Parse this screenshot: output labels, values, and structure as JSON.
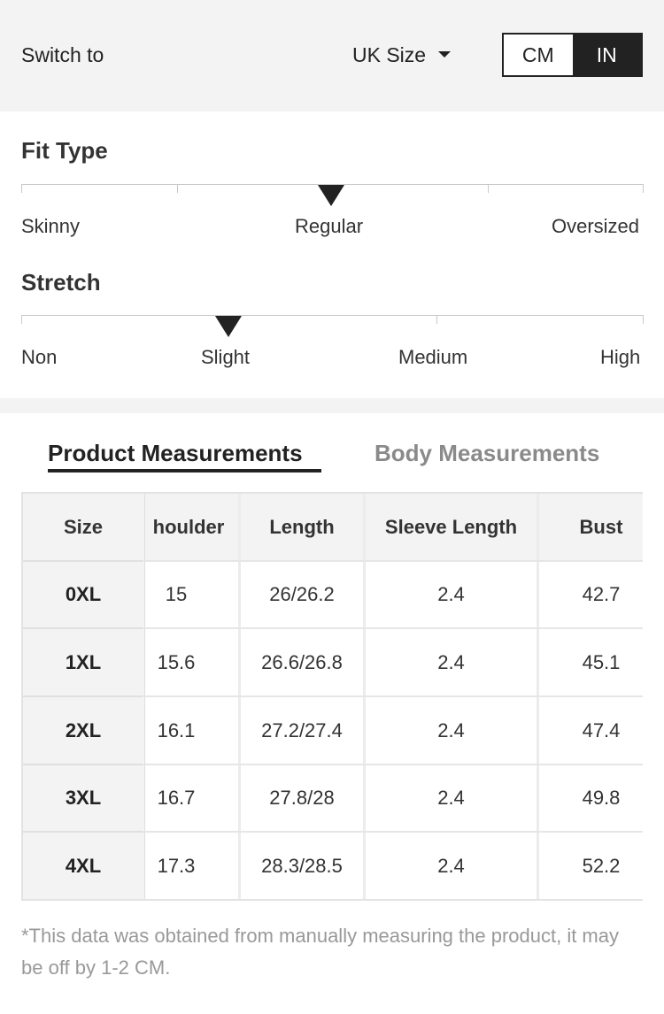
{
  "header": {
    "switch_label": "Switch to",
    "size_system": "UK Size",
    "units": [
      {
        "label": "CM",
        "active": false
      },
      {
        "label": "IN",
        "active": true
      }
    ]
  },
  "fit": {
    "title": "Fit Type",
    "labels": [
      "Skinny",
      "Regular",
      "Oversized"
    ],
    "selected": "Regular"
  },
  "stretch": {
    "title": "Stretch",
    "labels": [
      "Non",
      "Slight",
      "Medium",
      "High"
    ],
    "selected": "Slight"
  },
  "tabs": [
    {
      "label": "Product Measurements",
      "active": true
    },
    {
      "label": "Body Measurements",
      "active": false
    }
  ],
  "table": {
    "headers": [
      "Size",
      "houlder",
      "Length",
      "Sleeve Length",
      "Bust"
    ],
    "rows": [
      [
        "0XL",
        "15",
        "26/26.2",
        "2.4",
        "42.7"
      ],
      [
        "1XL",
        "15.6",
        "26.6/26.8",
        "2.4",
        "45.1"
      ],
      [
        "2XL",
        "16.1",
        "27.2/27.4",
        "2.4",
        "47.4"
      ],
      [
        "3XL",
        "16.7",
        "27.8/28",
        "2.4",
        "49.8"
      ],
      [
        "4XL",
        "17.3",
        "28.3/28.5",
        "2.4",
        "52.2"
      ]
    ]
  },
  "note": "*This data was obtained from manually measuring the product, it may be off by 1-2 CM."
}
